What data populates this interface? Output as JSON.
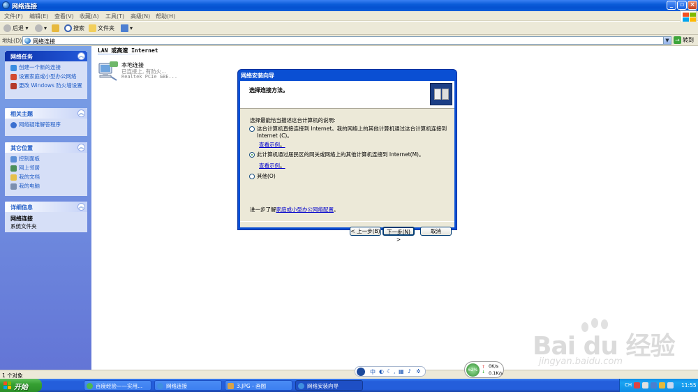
{
  "window": {
    "title": "网络连接"
  },
  "menu": [
    "文件(F)",
    "编辑(E)",
    "查看(V)",
    "收藏(A)",
    "工具(T)",
    "高级(N)",
    "帮助(H)"
  ],
  "toolbar": {
    "back": "后退",
    "search": "搜索",
    "folders": "文件夹"
  },
  "address": {
    "label": "地址(D)",
    "value": "网络连接",
    "go": "转到"
  },
  "sidebar": {
    "network_tasks": {
      "title": "网络任务",
      "items": [
        "创建一个新的连接",
        "设置家庭或小型办公网络",
        "更改 Windows 防火墙设置"
      ]
    },
    "related": {
      "title": "相关主题",
      "items": [
        "网络疑难解答程序"
      ]
    },
    "other_places": {
      "title": "其它位置",
      "items": [
        "控制面板",
        "网上邻居",
        "我的文档",
        "我的电脑"
      ]
    },
    "details": {
      "title": "详细信息",
      "name": "网络连接",
      "type": "系统文件夹"
    }
  },
  "content": {
    "group_title": "LAN 或高速 Internet",
    "connection": {
      "name": "本地连接",
      "status": "已连接上, 有防火...",
      "device": "Realtek PCIe GBE..."
    }
  },
  "dialog": {
    "title": "网络安装向导",
    "header": "选择连接方法。",
    "prompt": "选择最能恰当描述这台计算机的说明:",
    "option1_line1": "这台计算机直接连接到 Internet。我的网络上的其他计算机通过这台计算机连接到",
    "option1_line2": "Internet (C)。",
    "option2": "此计算机通过居民区的网关或网络上的其他计算机连接到 Internet(M)。",
    "option3": "其他(O)",
    "example_link": "查看示例",
    "example_suffix": "。",
    "learn_prefix": "进一步了解",
    "learn_link": "家庭或小型办公网络配置",
    "learn_suffix": "。",
    "back_button": "< 上一步(B)",
    "next_button": "下一步(N) >",
    "cancel_button": "取消",
    "selected_option": 2
  },
  "statusbar": {
    "text": "1 个对象"
  },
  "langbar": {
    "mode": "中"
  },
  "netmeter": {
    "percent": "62%",
    "up": "0K/s",
    "down": "0.1K/s"
  },
  "taskbar": {
    "start": "开始",
    "tasks": [
      "百度经验——实用...",
      "网络连接",
      "3.JPG - 画图",
      "网络安装向导"
    ],
    "tray_lang": "CH",
    "clock": "11:55"
  },
  "watermark": {
    "brand": "Bai du 经验",
    "url": "jingyan.baidu.com"
  },
  "colors": {
    "xp_blue": "#0a5bd8",
    "taskpane": "#7ba2e7",
    "start_green": "#36a033",
    "link": "#0000cc"
  }
}
